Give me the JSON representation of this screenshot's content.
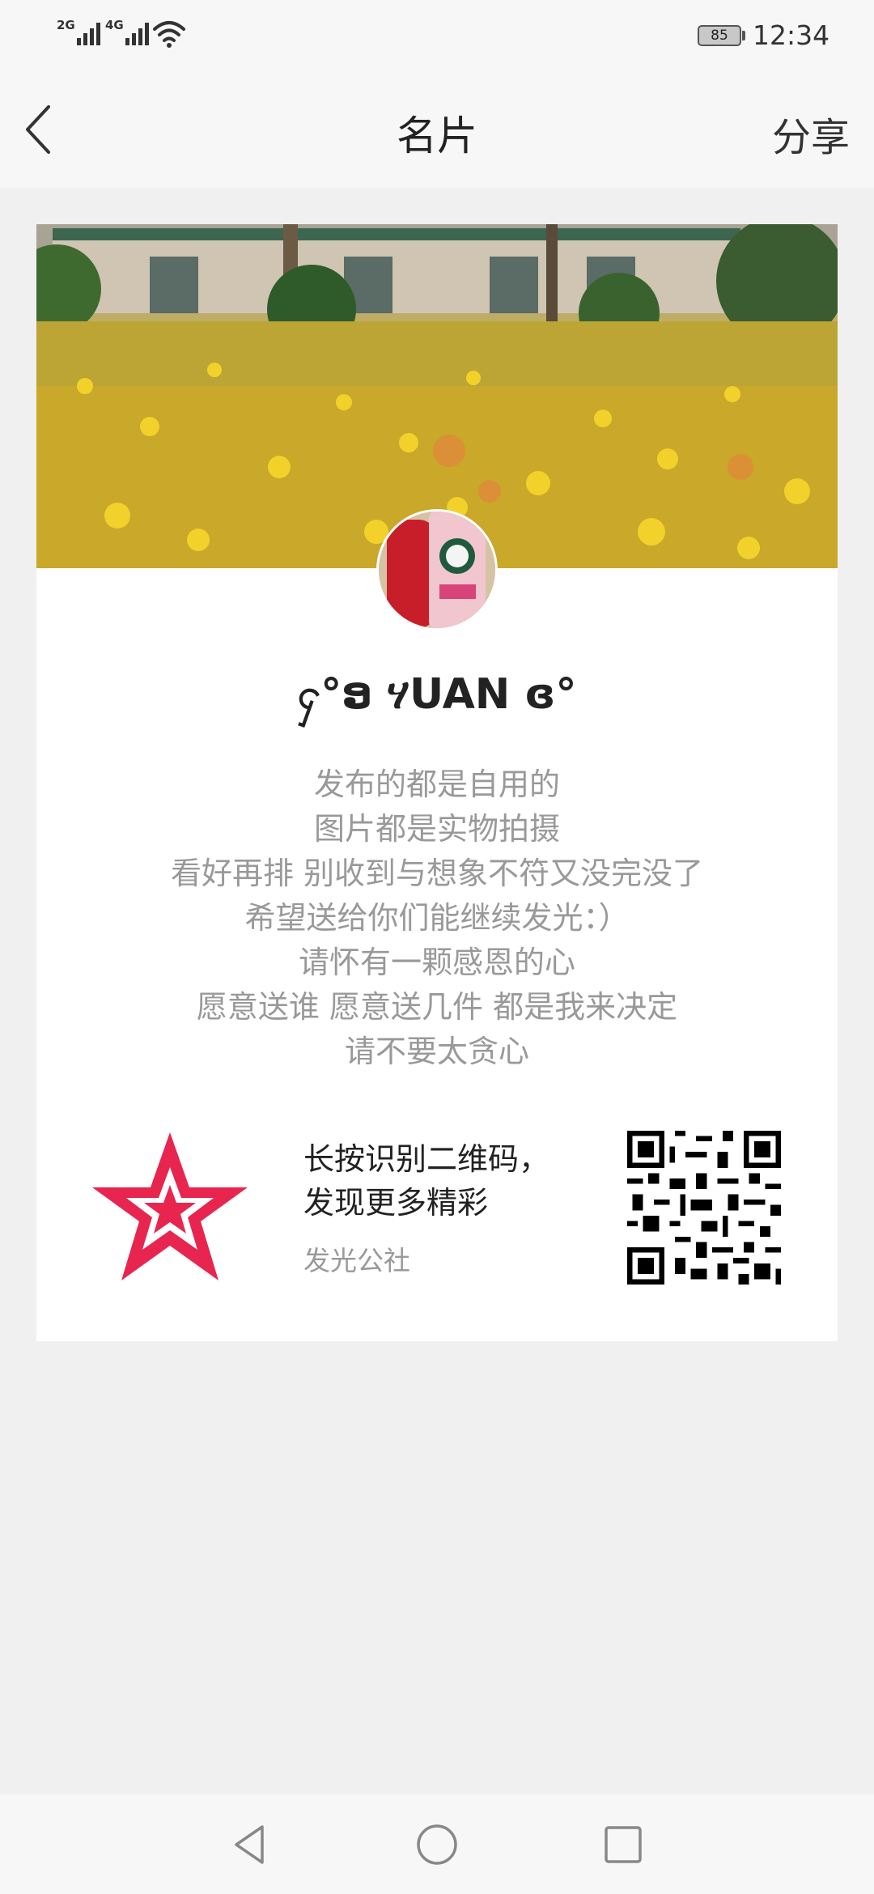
{
  "status_bar": {
    "sim1_label": "2G",
    "sim2_label": "4G",
    "battery_level": "85",
    "time": "12:34"
  },
  "nav": {
    "title": "名片",
    "share_label": "分享"
  },
  "card": {
    "username": "ႁ°ອ ሃUAN ɞ°",
    "bio_lines": [
      "发布的都是自用的",
      "图片都是实物拍摄",
      "看好再排 别收到与想象不符又没完没了",
      "希望送给你们能继续发光：）",
      "请怀有一颗感恩的心",
      "愿意送谁 愿意送几件 都是我来决定",
      "请不要太贪心"
    ],
    "promo_line1": "长按识别二维码，",
    "promo_line2": "发现更多精彩",
    "promo_source": "发光公社"
  },
  "icons": {
    "back": "chevron-left-icon",
    "logo": "star-logo-icon",
    "qr": "qr-code",
    "nav_back": "triangle-back-icon",
    "nav_home": "circle-home-icon",
    "nav_recent": "square-recent-icon"
  },
  "colors": {
    "logo_red": "#e8254f",
    "bio_gray": "#999999"
  }
}
